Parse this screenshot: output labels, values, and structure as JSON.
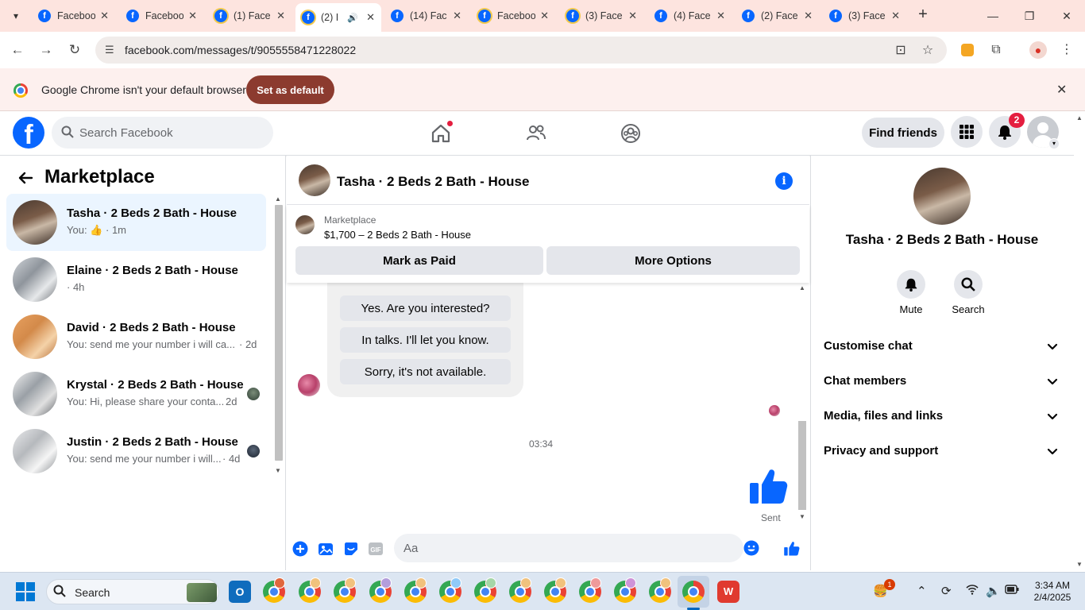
{
  "browser": {
    "tabs": [
      {
        "title": "Facebook",
        "active": false
      },
      {
        "title": "Facebook",
        "active": false
      },
      {
        "title": "(1) Face",
        "active": false
      },
      {
        "title": "(2) I",
        "active": true
      },
      {
        "title": "(14) Fac",
        "active": false
      },
      {
        "title": "Facebook",
        "active": false
      },
      {
        "title": "(3) Face",
        "active": false
      },
      {
        "title": "(4) Face",
        "active": false
      },
      {
        "title": "(2) Face",
        "active": false
      },
      {
        "title": "(3) Face",
        "active": false
      }
    ],
    "url": "facebook.com/messages/t/9055558471228022",
    "banner": {
      "message": "Google Chrome isn't your default browser",
      "button": "Set as default"
    }
  },
  "fb_header": {
    "search_placeholder": "Search Facebook",
    "find_friends": "Find friends",
    "notification_count": "2"
  },
  "marketplace": {
    "title": "Marketplace",
    "conversations": [
      {
        "title": "Tasha · 2 Beds 2 Bath - House",
        "preview_prefix": "You:",
        "preview": "",
        "time": "· 1m",
        "active": true
      },
      {
        "title": "Elaine · 2 Beds 2 Bath - House",
        "preview_prefix": "",
        "preview": "",
        "time": "· 4h",
        "active": false
      },
      {
        "title": "David · 2 Beds 2 Bath - House",
        "preview_prefix": "",
        "preview": "You: send me your number i will ca...",
        "time": "· 2d",
        "active": false
      },
      {
        "title": "Krystal · 2 Beds 2 Bath - House",
        "preview_prefix": "",
        "preview": "You: Hi, please share your conta...",
        "time": "2d",
        "active": false
      },
      {
        "title": "Justin · 2 Beds 2 Bath - House",
        "preview_prefix": "",
        "preview": "You: send me your number i will...",
        "time": "· 4d",
        "active": false
      }
    ]
  },
  "chat": {
    "name": "Tasha · 2 Beds 2 Bath - House",
    "listing": {
      "label": "Marketplace",
      "price_title": "$1,700 – 2 Beds 2 Bath - House",
      "mark_paid": "Mark as Paid",
      "more_options": "More Options"
    },
    "quick_replies": [
      "Yes. Are you interested?",
      "In talks. I'll let you know.",
      "Sorry, it's not available."
    ],
    "timestamp": "03:34",
    "sent_label": "Sent",
    "composer_placeholder": "Aa"
  },
  "details": {
    "name": "Tasha · 2 Beds 2 Bath - House",
    "actions": [
      {
        "label": "Mute",
        "icon": "bell-icon"
      },
      {
        "label": "Search",
        "icon": "search-icon"
      }
    ],
    "sections": [
      "Customise chat",
      "Chat members",
      "Media, files and links",
      "Privacy and support"
    ]
  },
  "taskbar": {
    "search_label": "Search",
    "time": "3:34 AM",
    "date": "2/4/2025",
    "tray_badge": "1"
  },
  "colors": {
    "fb_blue": "#0866ff",
    "tab_strip": "#fde4df",
    "banner_button": "#8c3b2f",
    "badge_red": "#e41e3f"
  }
}
